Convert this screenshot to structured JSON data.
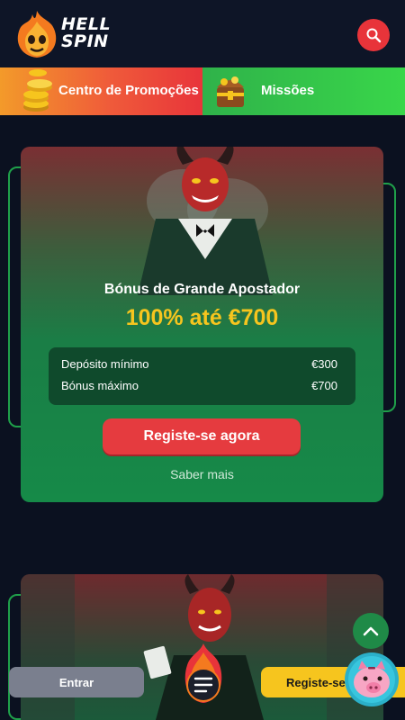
{
  "header": {
    "logo": {
      "line1": "HELL",
      "line2": "SPIN"
    },
    "search_icon": "search-icon"
  },
  "promo_nav": {
    "items": [
      {
        "label": "Centro de Promoções",
        "icon": "coins-icon",
        "color": "#ef5a3a"
      },
      {
        "label": "Missões",
        "icon": "treasure-chest-icon",
        "color": "#39d64a"
      }
    ]
  },
  "bonus_card": {
    "title": "Bónus de Grande Apostador",
    "offer": "100% até €700",
    "details": [
      {
        "label": "Depósito mínimo",
        "value": "€300"
      },
      {
        "label": "Bónus máximo",
        "value": "€700"
      }
    ],
    "cta": "Registe-se agora",
    "link": "Saber mais",
    "image": "devil-character-illustration"
  },
  "second_card": {
    "image": "devil-character-illustration"
  },
  "bottom_bar": {
    "login": "Entrar",
    "menu_icon": "menu-icon",
    "signup": "Registe-se agora",
    "scroll_top_icon": "chevron-up-icon",
    "piggy_icon": "piggy-bank-icon"
  },
  "colors": {
    "accent_red": "#e53b3f",
    "gold": "#f6c51e",
    "green": "#168a48",
    "background": "#0b1120"
  }
}
